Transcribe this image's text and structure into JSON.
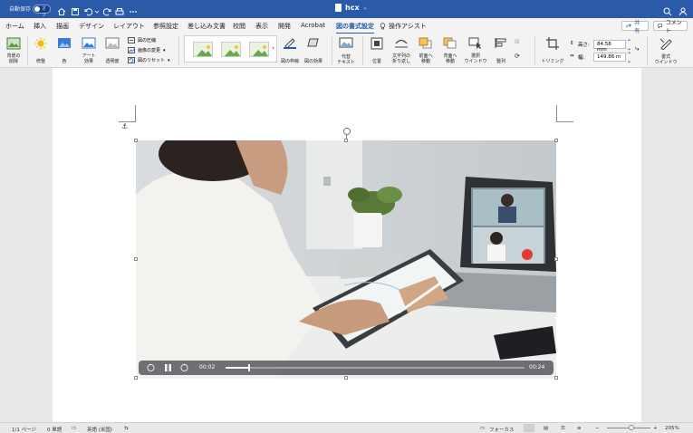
{
  "titlebar": {
    "autosave_label": "自動保存",
    "autosave_state": "オフ",
    "doc_title": "hcx"
  },
  "tabs": [
    "ホーム",
    "挿入",
    "描画",
    "デザイン",
    "レイアウト",
    "参照設定",
    "差し込み文書",
    "校閲",
    "表示",
    "開発",
    "Acrobat",
    "図の書式設定",
    "操作アシスト"
  ],
  "active_tab": "図の書式設定",
  "share_label": "共有",
  "comment_label": "コメント",
  "ribbon": {
    "remove_bg": [
      "背景の",
      "削除"
    ],
    "corrections": "修整",
    "color": "色",
    "artistic": [
      "アート",
      "効果"
    ],
    "transparency": "透明度",
    "compress": "図の圧縮",
    "change_picture": "画像の変更",
    "reset_picture": "図のリセット",
    "picture_border": "図の枠線",
    "picture_effects": "図の効果",
    "alt_text": [
      "代替",
      "テキスト"
    ],
    "position": "位置",
    "wrap_text": [
      "文字列の",
      "折り返し"
    ],
    "bring_forward": [
      "前面へ",
      "移動"
    ],
    "send_backward": [
      "背面へ",
      "移動"
    ],
    "selection_pane": [
      "選択",
      "ウインドウ"
    ],
    "align": "整列",
    "crop": "トリミング",
    "height_label": "高さ:",
    "height_value": "84.58 mm",
    "width_label": "幅:",
    "width_value": "149.86 m",
    "format_pane": [
      "書式",
      "ウインドウ"
    ]
  },
  "video": {
    "current_time": "00:02",
    "total_time": "00:24",
    "progress": 0.08,
    "alt": "ビデオ会議をしながらタブレットで作業する人"
  },
  "statusbar": {
    "page": "1/1 ページ",
    "words": "0 単語",
    "language": "英語 (米国)",
    "focus": "フォーカス",
    "zoom": "205%"
  },
  "colors": {
    "accent": "#2b5ba8",
    "titlebar": "#2b5ba8"
  }
}
